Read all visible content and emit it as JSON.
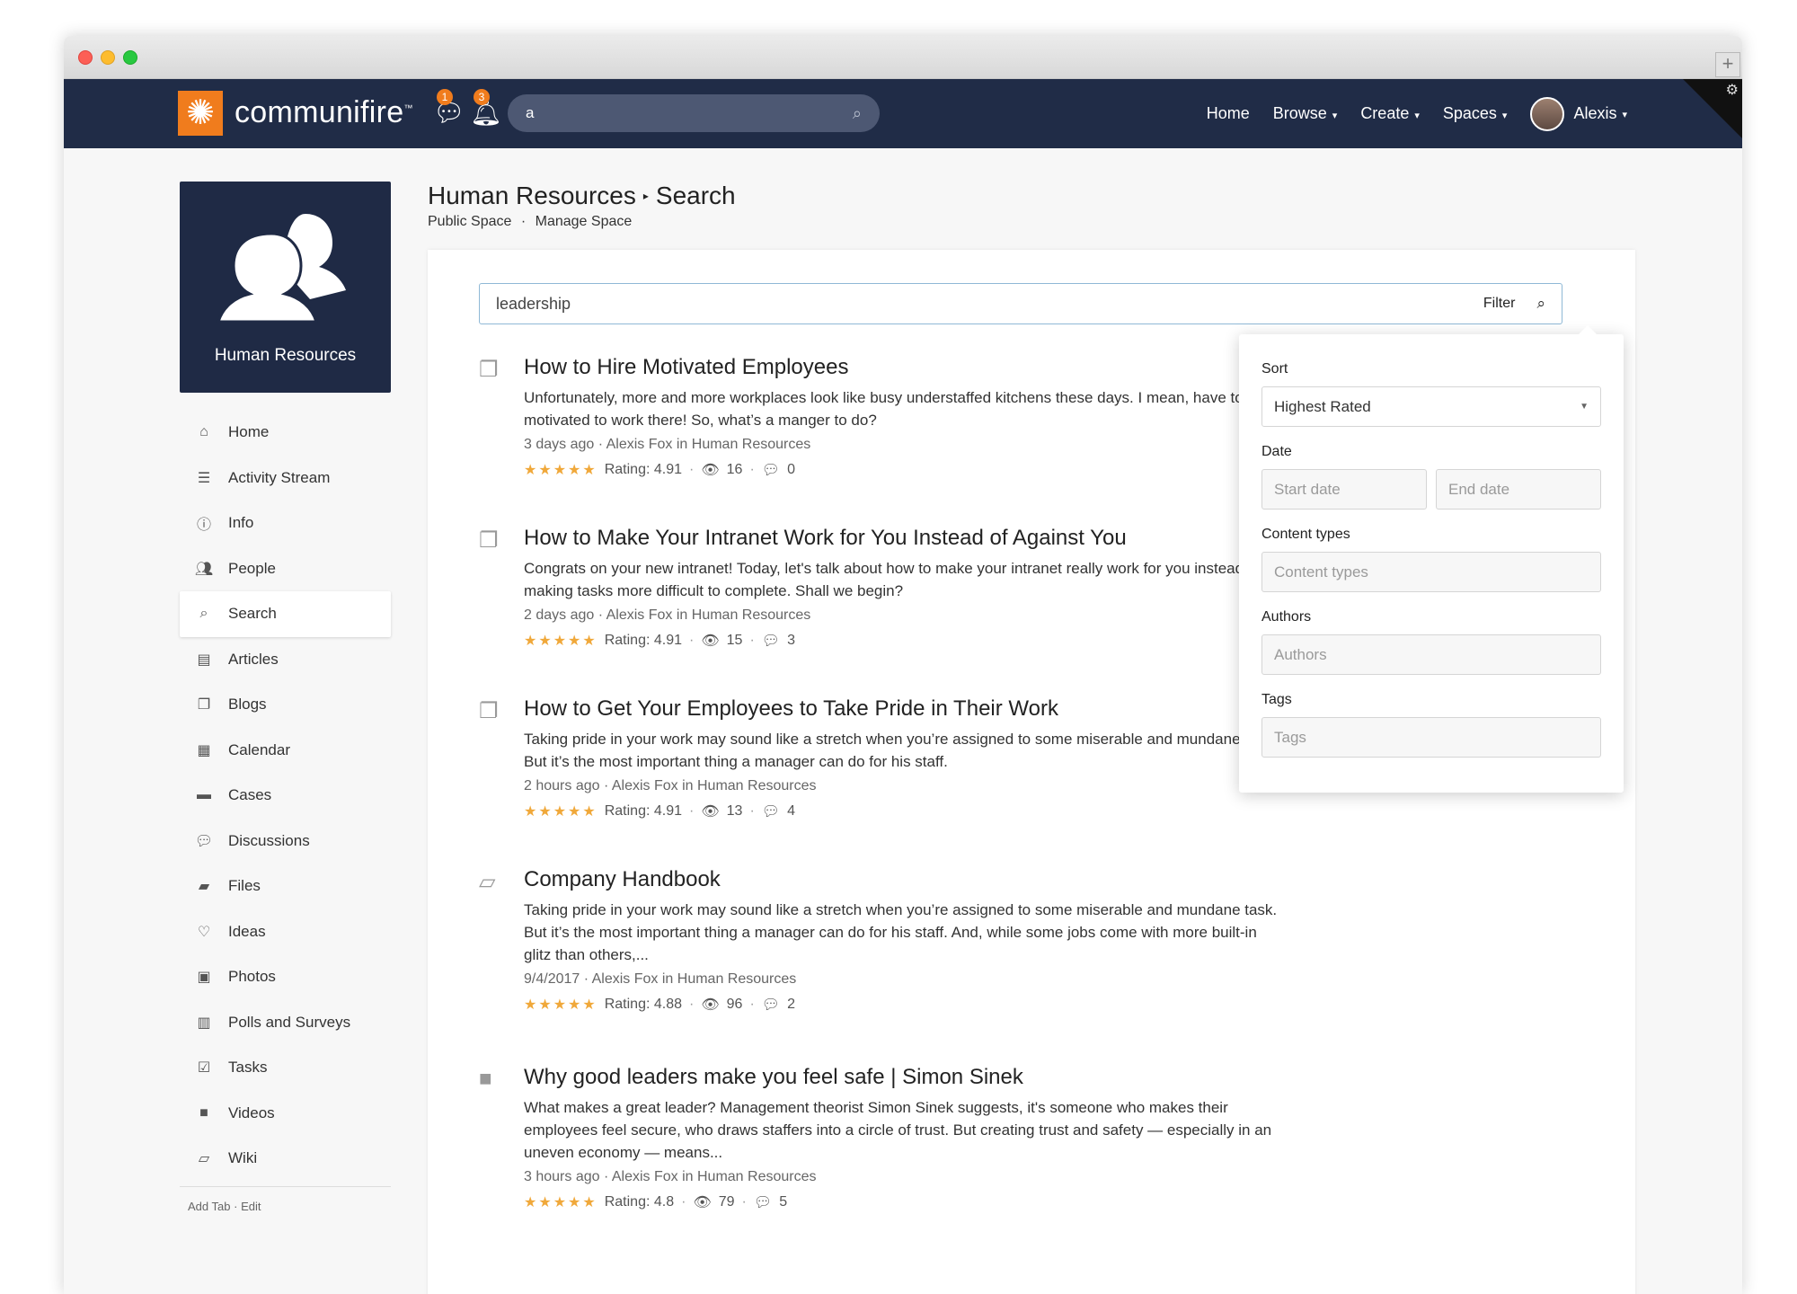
{
  "app": {
    "logo_text": "communifire",
    "logo_tm": "™"
  },
  "topnav": {
    "messages_badge": "1",
    "notifications_badge": "3",
    "search_value": "a",
    "links": [
      {
        "label": "Home"
      },
      {
        "label": "Browse",
        "caret": "▾"
      },
      {
        "label": "Create",
        "caret": "▾"
      },
      {
        "label": "Spaces",
        "caret": "▾"
      },
      {
        "label": "Alexis",
        "caret": "▾"
      }
    ]
  },
  "space": {
    "name": "Human Resources"
  },
  "sidebar": {
    "items": [
      {
        "label": "Home",
        "icon": "home-icon"
      },
      {
        "label": "Activity Stream",
        "icon": "list-icon"
      },
      {
        "label": "Info",
        "icon": "info-icon"
      },
      {
        "label": "People",
        "icon": "people-icon"
      },
      {
        "label": "Search",
        "icon": "search-icon"
      },
      {
        "label": "Articles",
        "icon": "document-icon"
      },
      {
        "label": "Blogs",
        "icon": "blogs-icon"
      },
      {
        "label": "Calendar",
        "icon": "calendar-icon"
      },
      {
        "label": "Cases",
        "icon": "briefcase-icon"
      },
      {
        "label": "Discussions",
        "icon": "discussion-icon"
      },
      {
        "label": "Files",
        "icon": "folder-icon"
      },
      {
        "label": "Ideas",
        "icon": "lightbulb-icon"
      },
      {
        "label": "Photos",
        "icon": "image-icon"
      },
      {
        "label": "Polls and Surveys",
        "icon": "chart-icon"
      },
      {
        "label": "Tasks",
        "icon": "checkbox-icon"
      },
      {
        "label": "Videos",
        "icon": "video-icon"
      },
      {
        "label": "Wiki",
        "icon": "book-icon"
      }
    ],
    "footer": {
      "add_tab": "Add Tab",
      "sep": "·",
      "edit": "Edit"
    }
  },
  "header": {
    "space": "Human Resources",
    "page": "Search",
    "sub_public": "Public Space",
    "sub_sep": "·",
    "sub_manage": "Manage Space"
  },
  "search": {
    "query": "leadership",
    "filter_label": "Filter"
  },
  "results": [
    {
      "title": "How to Hire Motivated Employees",
      "desc": "Unfortunately, more and more workplaces look like busy understaffed kitchens these days. I mean, have to be motivated to work there! So, what’s a manger to do?",
      "meta": "3 days ago · Alexis Fox in Human Resources",
      "rating": "Rating: 4.91",
      "views": "16",
      "comments": "0",
      "icon": "blog-post-icon"
    },
    {
      "title": "How to Make Your Intranet Work for You Instead of Against You",
      "desc": "Congrats on your new intranet! Today, let's talk about how to make your intranet really work for you instead of making tasks more difficult to complete. Shall we begin?",
      "meta": "2 days ago · Alexis Fox in Human Resources",
      "rating": "Rating: 4.91",
      "views": "15",
      "comments": "3",
      "icon": "blog-post-icon"
    },
    {
      "title": "How to Get Your Employees to Take Pride in Their Work",
      "desc": "Taking pride in your work may sound like a stretch when you’re assigned to some miserable and mundane task. But it’s the most important thing a manager can do for his staff.",
      "meta": "2 hours ago · Alexis Fox in Human Resources",
      "rating": "Rating: 4.91",
      "views": "13",
      "comments": "4",
      "icon": "blog-post-icon"
    },
    {
      "title": "Company Handbook",
      "desc": "Taking pride in your work may sound like a stretch when you’re assigned to some miserable and mundane task. But it’s the most important thing a manager can do for his staff. And, while some jobs come with more built-in glitz than others,...",
      "meta": "9/4/2017 · Alexis Fox in Human Resources",
      "rating": "Rating: 4.88",
      "views": "96",
      "comments": "2",
      "icon": "book-icon"
    },
    {
      "title": "Why good leaders make you feel safe | Simon Sinek",
      "desc": "What makes a great leader? Management theorist Simon Sinek suggests, it's someone who makes their employees feel secure, who draws staffers into a circle of trust. But creating trust and safety — especially in an uneven economy — means...",
      "meta": "3 hours ago · Alexis Fox in Human Resources",
      "rating": "Rating: 4.8",
      "views": "79",
      "comments": "5",
      "icon": "video-icon"
    }
  ],
  "filter_panel": {
    "sort_label": "Sort",
    "sort_value": "Highest Rated",
    "date_label": "Date",
    "start_placeholder": "Start date",
    "end_placeholder": "End date",
    "content_label": "Content types",
    "content_placeholder": "Content types",
    "authors_label": "Authors",
    "authors_placeholder": "Authors",
    "tags_label": "Tags",
    "tags_placeholder": "Tags"
  },
  "colors": {
    "nav": "#202c47",
    "accent": "#f07c1d",
    "stars": "#f0a83a"
  }
}
